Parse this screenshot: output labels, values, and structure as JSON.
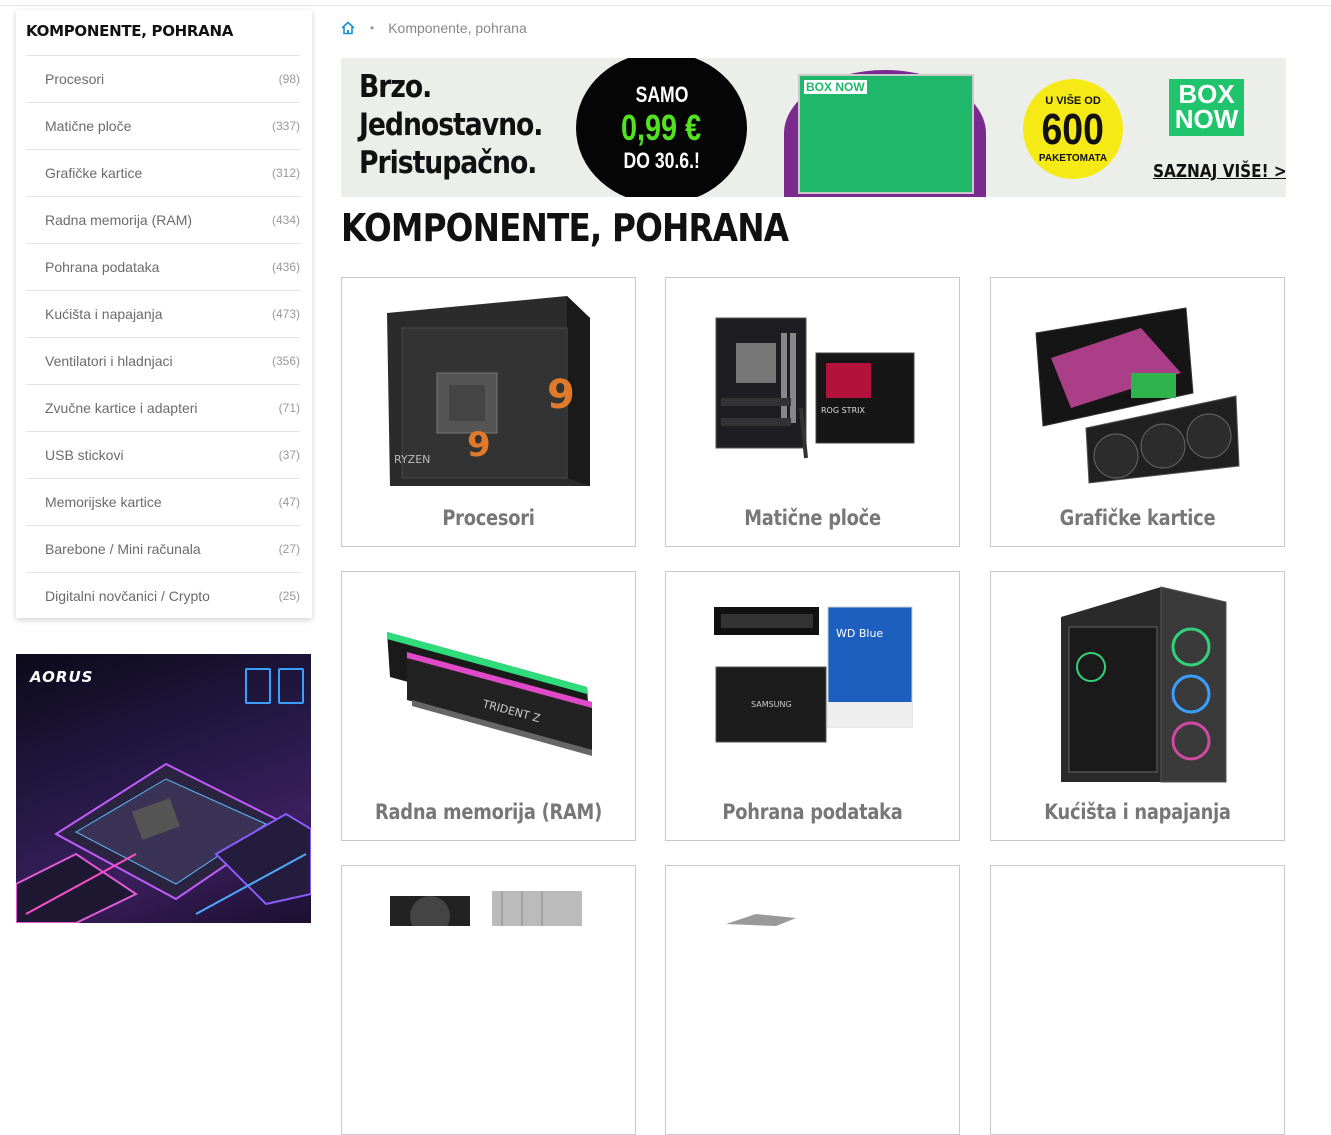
{
  "sidebar": {
    "title": "KOMPONENTE, POHRANA",
    "items": [
      {
        "label": "Procesori",
        "count": "(98)"
      },
      {
        "label": "Matične ploče",
        "count": "(337)"
      },
      {
        "label": "Grafičke kartice",
        "count": "(312)"
      },
      {
        "label": "Radna memorija (RAM)",
        "count": "(434)"
      },
      {
        "label": "Pohrana podataka",
        "count": "(436)"
      },
      {
        "label": "Kućišta i napajanja",
        "count": "(473)"
      },
      {
        "label": "Ventilatori i hladnjaci",
        "count": "(356)"
      },
      {
        "label": "Zvučne kartice i adapteri",
        "count": "(71)"
      },
      {
        "label": "USB stickovi",
        "count": "(37)"
      },
      {
        "label": "Memorijske kartice",
        "count": "(47)"
      },
      {
        "label": "Barebone / Mini računala",
        "count": "(27)"
      },
      {
        "label": "Digitalni novčanici / Crypto",
        "count": "(25)"
      }
    ]
  },
  "promo": {
    "brand": "AORUS"
  },
  "breadcrumb": {
    "home_icon": "home-icon",
    "current": "Komponente, pohrana"
  },
  "banner": {
    "slogan_line1": "Brzo.",
    "slogan_line2": "Jednostavno.",
    "slogan_line3": "Pristupačno.",
    "price_top": "SAMO",
    "price": "0,99 €",
    "price_bottom": "DO 30.6.!",
    "locker_logo": "BOX NOW",
    "yellow_top": "U VIŠE OD",
    "yellow_number": "600",
    "yellow_bottom": "PAKETOMATA",
    "brand": "BOX NOW",
    "cta": "SAZNAJ VIŠE! >",
    "accent": "#1fc46c"
  },
  "page": {
    "title": "KOMPONENTE, POHRANA"
  },
  "categories": [
    {
      "name": "Procesori"
    },
    {
      "name": "Matične ploče"
    },
    {
      "name": "Grafičke kartice"
    },
    {
      "name": "Radna memorija (RAM)"
    },
    {
      "name": "Pohrana podataka"
    },
    {
      "name": "Kućišta i napajanja"
    }
  ],
  "colors": {
    "accent_link": "#1a8fd6"
  }
}
